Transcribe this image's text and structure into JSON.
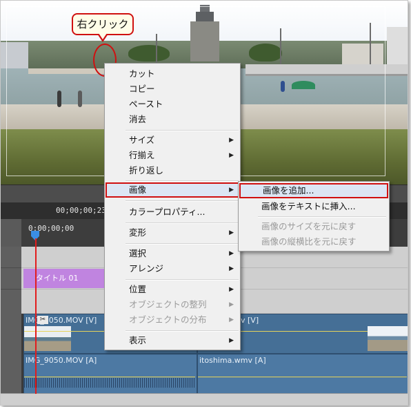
{
  "annotation": {
    "callout_text": "右クリック"
  },
  "timeline": {
    "current_time": "00;00;00;23",
    "ruler_start": "0;00;00;00",
    "title_clip": "タイトル 01",
    "video_clip_1": "IMG_9050.MOV [V]",
    "video_clip_2": "v [V]",
    "audio_clip_1": "IMG_9050.MOV [A]",
    "audio_clip_2": "itoshima.wmv [A]"
  },
  "context_menu": {
    "items": [
      {
        "label": "カット",
        "submenu": false,
        "disabled": false
      },
      {
        "label": "コピー",
        "submenu": false,
        "disabled": false
      },
      {
        "label": "ペースト",
        "submenu": false,
        "disabled": false
      },
      {
        "label": "消去",
        "submenu": false,
        "disabled": false
      },
      {
        "label": "サイズ",
        "submenu": true,
        "disabled": false
      },
      {
        "label": "行揃え",
        "submenu": true,
        "disabled": false
      },
      {
        "label": "折り返し",
        "submenu": false,
        "disabled": false
      },
      {
        "label": "画像",
        "submenu": true,
        "disabled": false,
        "highlighted": true
      },
      {
        "label": "カラープロパティ...",
        "submenu": false,
        "disabled": false
      },
      {
        "label": "変形",
        "submenu": true,
        "disabled": false
      },
      {
        "label": "選択",
        "submenu": true,
        "disabled": false
      },
      {
        "label": "アレンジ",
        "submenu": true,
        "disabled": false
      },
      {
        "label": "位置",
        "submenu": true,
        "disabled": false
      },
      {
        "label": "オブジェクトの整列",
        "submenu": true,
        "disabled": true
      },
      {
        "label": "オブジェクトの分布",
        "submenu": true,
        "disabled": true
      },
      {
        "label": "表示",
        "submenu": true,
        "disabled": false
      }
    ],
    "submenu_arrow": "▶"
  },
  "image_submenu": {
    "items": [
      {
        "label": "画像を追加...",
        "disabled": false,
        "highlighted": true
      },
      {
        "label": "画像をテキストに挿入...",
        "disabled": false
      },
      {
        "label": "画像のサイズを元に戻す",
        "disabled": true
      },
      {
        "label": "画像の縦横比を元に戻す",
        "disabled": true
      }
    ]
  },
  "colors": {
    "highlight_border": "#d01010",
    "playhead": "#e21d1d",
    "title_clip": "#c084e0",
    "video_clip": "#456f96"
  }
}
